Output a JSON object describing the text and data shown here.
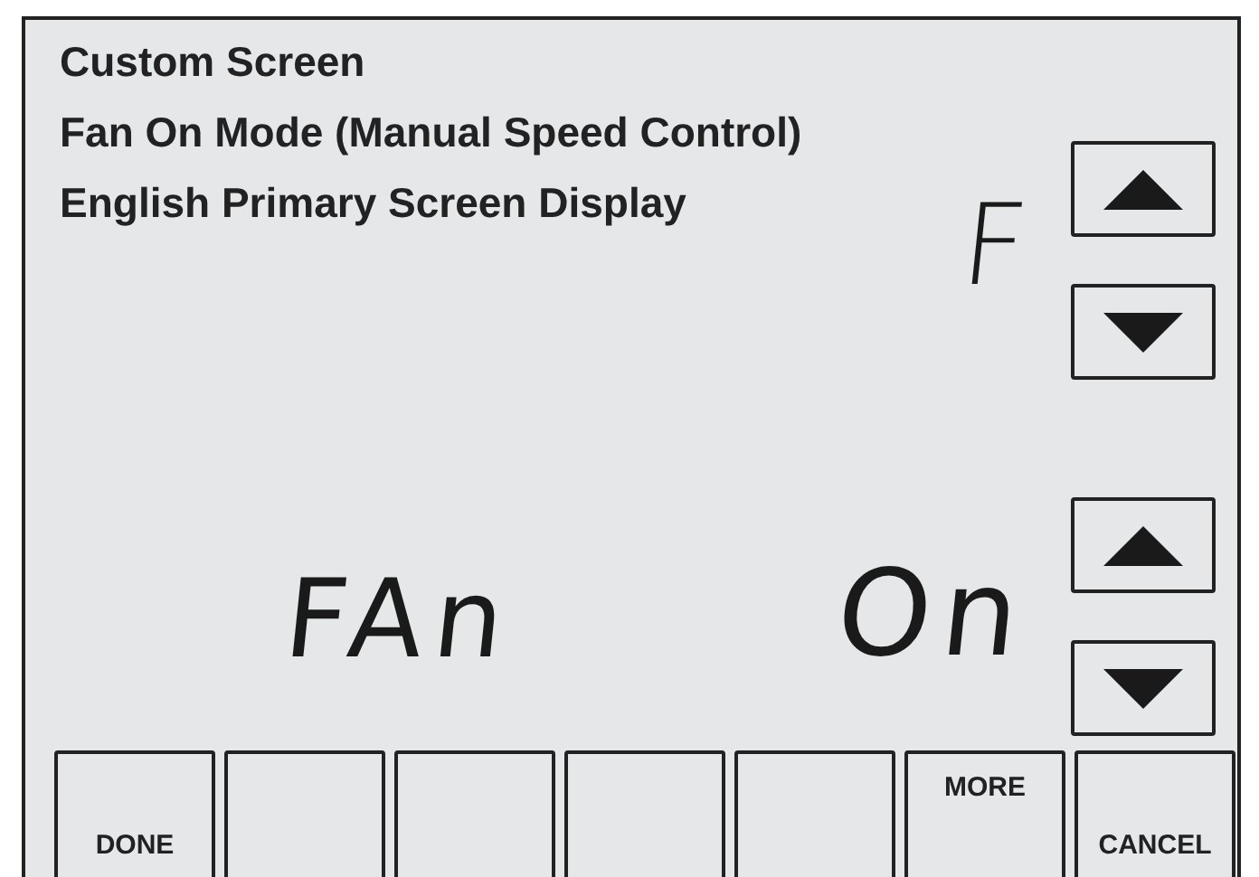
{
  "header_lines": [
    "Custom Screen",
    "Fan On Mode (Manual Speed Control)",
    "English Primary Screen Display"
  ],
  "upper_readout": "F",
  "lower_readout": {
    "label": "FAn",
    "value": "On"
  },
  "upper_arrows": [
    {
      "kind": "up"
    },
    {
      "kind": "down"
    }
  ],
  "lower_arrows": [
    {
      "kind": "up"
    },
    {
      "kind": "down"
    }
  ],
  "softkeys": [
    {
      "label": "DONE",
      "kind": "bottom"
    },
    {
      "kind": "blank"
    },
    {
      "kind": "blank"
    },
    {
      "kind": "blank"
    },
    {
      "kind": "blank"
    },
    {
      "label": "MORE",
      "kind": "top"
    },
    {
      "label": "CANCEL",
      "kind": "bottom"
    }
  ]
}
